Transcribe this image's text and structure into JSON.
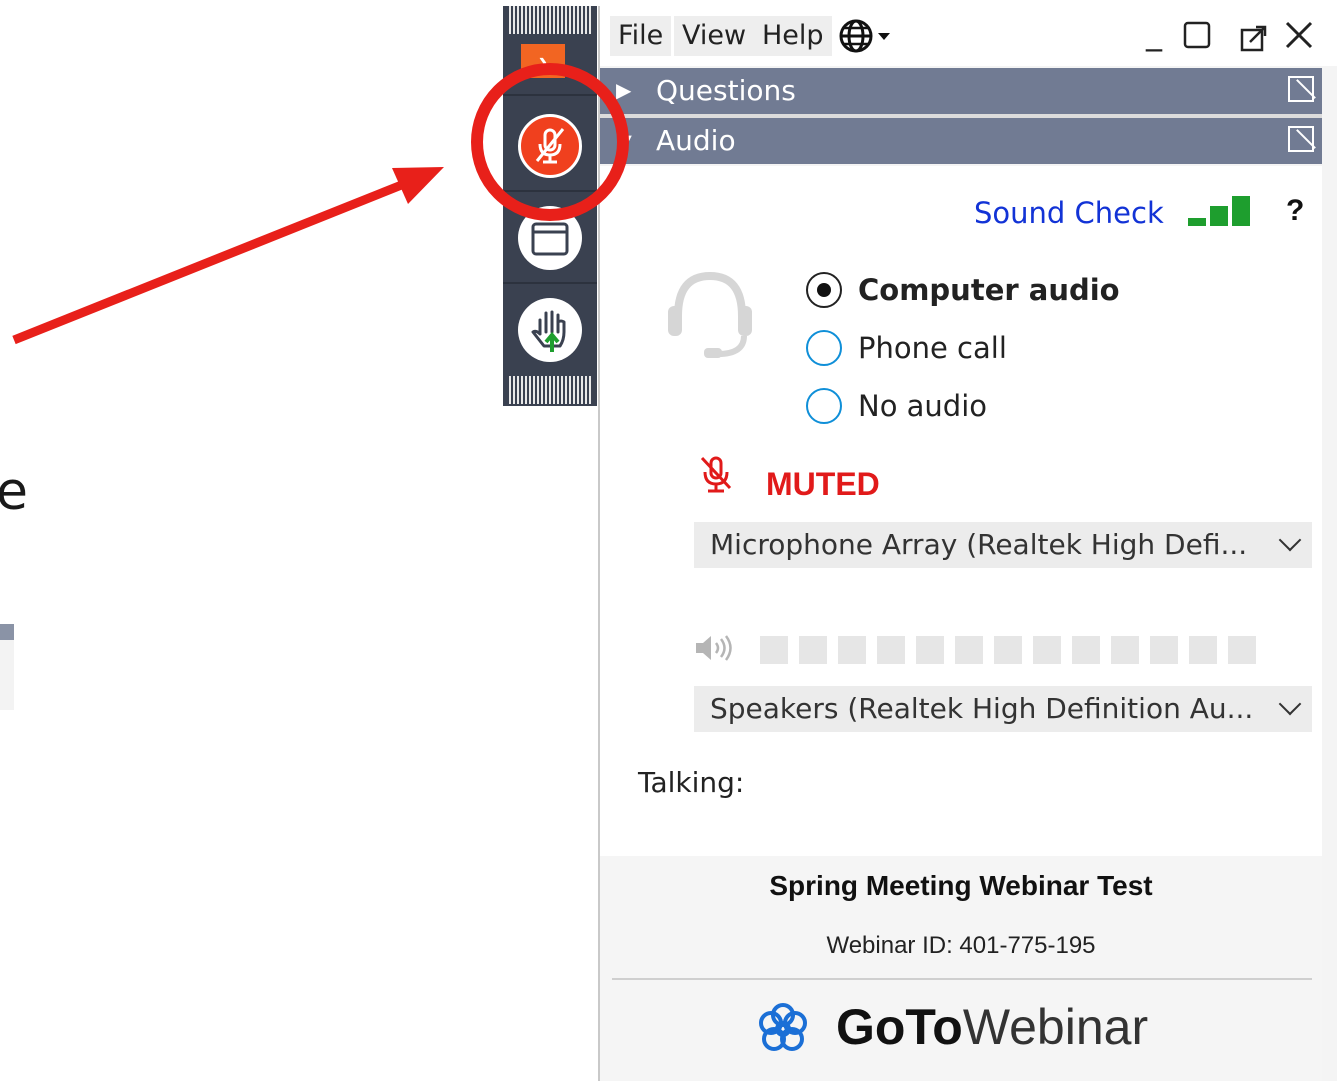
{
  "background": {
    "fragment_text": "e"
  },
  "menubar": {
    "items": [
      "File",
      "View",
      "Help"
    ],
    "language_icon": "globe-icon",
    "window_controls": [
      "minimize-icon",
      "maximize-icon",
      "popout-icon",
      "close-icon"
    ]
  },
  "panels": {
    "questions": {
      "label": "Questions",
      "state": "collapsed"
    },
    "audio": {
      "label": "Audio",
      "state": "expanded"
    }
  },
  "audio": {
    "sound_check": "Sound Check",
    "help": "?",
    "options": [
      {
        "label": "Computer audio",
        "selected": true
      },
      {
        "label": "Phone call",
        "selected": false
      },
      {
        "label": "No audio",
        "selected": false
      }
    ],
    "muted_label": "MUTED",
    "microphone": "Microphone Array (Realtek High Defi...",
    "speakers": "Speakers (Realtek High Definition Au...",
    "talking_label": "Talking:",
    "speaker_level": 0
  },
  "webinar": {
    "title": "Spring Meeting Webinar Test",
    "id_text": "Webinar ID: 401-775-195",
    "brand_bold": "GoTo",
    "brand_light": "Webinar"
  },
  "strip": {
    "buttons": [
      "expand-icon",
      "microphone-muted-icon",
      "screen-icon",
      "raise-hand-icon"
    ]
  },
  "colors": {
    "accent_red": "#e11a1a",
    "mic_button": "#f0401e",
    "panel_header": "#717b93",
    "link_blue": "#1233d6",
    "signal_green": "#1e9e2e",
    "annotation_red": "#e8201a"
  }
}
